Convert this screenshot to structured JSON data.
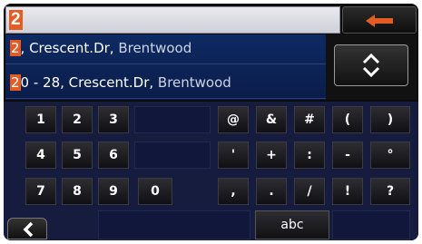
{
  "search": {
    "text": "2"
  },
  "results": [
    {
      "highlight": "2",
      "rest": ", Crescent.Dr, ",
      "suburb": "Brentwood"
    },
    {
      "highlight": "2",
      "rest": "0 - 28, Crescent.Dr, ",
      "suburb": "Brentwood"
    }
  ],
  "keys": {
    "row1": [
      "1",
      "2",
      "3",
      "@",
      "&",
      "#",
      "(",
      ")"
    ],
    "row2": [
      "4",
      "5",
      "6",
      "'",
      "+",
      ":",
      "-",
      "°"
    ],
    "row3": [
      "7",
      "8",
      "9",
      "0",
      ",",
      ".",
      "/",
      "!",
      "?"
    ]
  },
  "bottom": {
    "abc_label": "abc"
  },
  "icons": {
    "backspace": "left-arrow-icon",
    "scroll": "up-down-chevron-icon",
    "back": "chevron-left-icon"
  },
  "colors": {
    "accent": "#e55b24",
    "results_bg": "#0e2a63",
    "keypad_bg": "#151c3d"
  }
}
